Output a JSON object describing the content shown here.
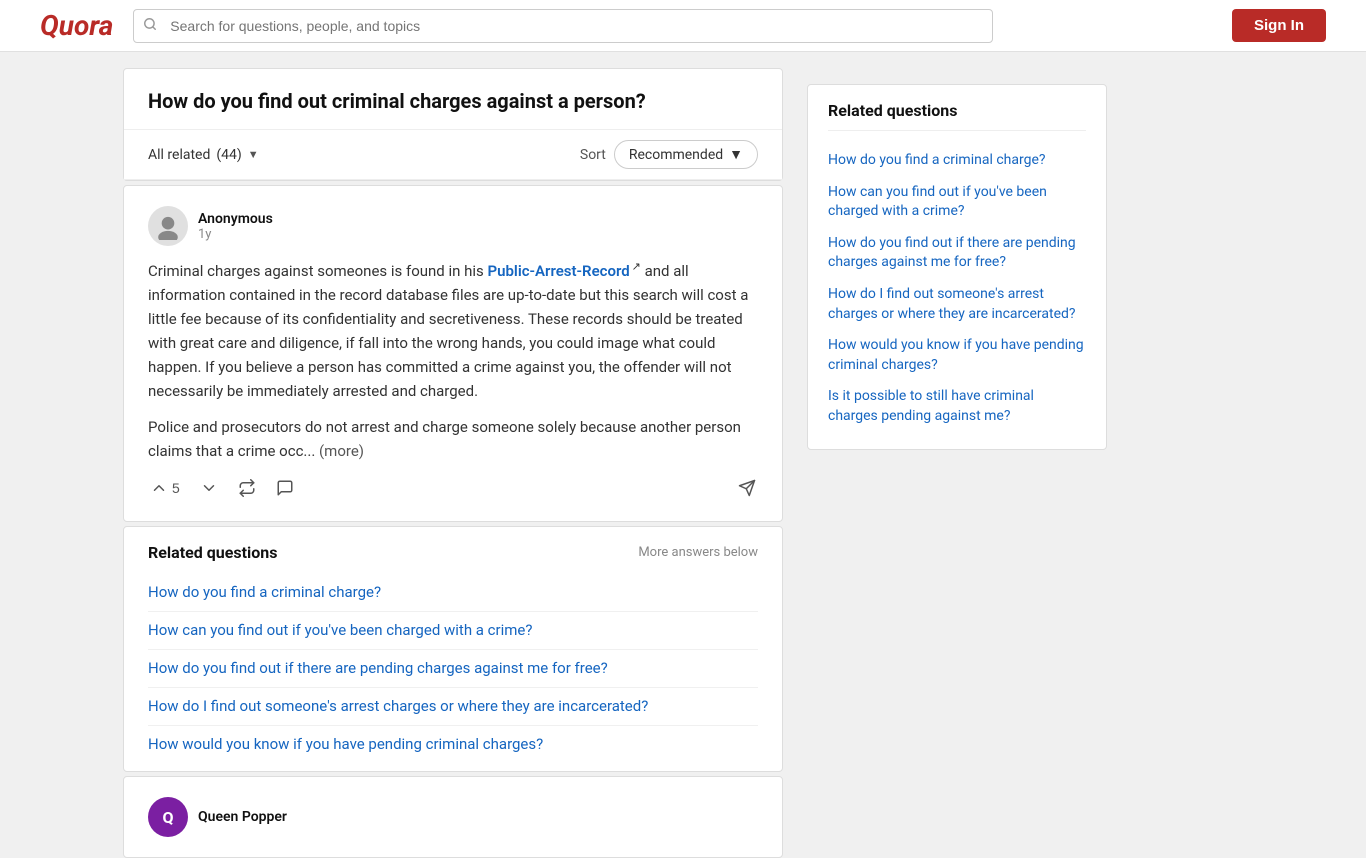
{
  "header": {
    "logo": "Quora",
    "search_placeholder": "Search for questions, people, and topics",
    "sign_in_label": "Sign In"
  },
  "question": {
    "title": "How do you find out criminal charges against a person?"
  },
  "filter": {
    "all_related_label": "All related",
    "all_related_count": "(44)",
    "sort_label": "Sort",
    "sort_value": "Recommended"
  },
  "answer": {
    "author_name": "Anonymous",
    "time_ago": "1y",
    "link_text": "Public-Arrest-Record",
    "body_before_link": "Criminal charges against someones is found in his ",
    "body_after_link": " and all information contained in the record database files are up-to-date but this search will cost a little fee because of its confidentiality and secretiveness. These records should be treated with great care and diligence, if fall into the wrong hands, you could image what could happen. If you believe a person has committed a crime against you, the offender will not necessarily be immediately arrested and charged.",
    "body_para2": "Police and prosecutors do not arrest and charge someone solely because another person claims that a crime occ...",
    "more_label": "(more)",
    "upvote_count": "5",
    "actions": {
      "upvote": "upvote",
      "downvote": "downvote",
      "share_answer": "share",
      "comment": "comment"
    }
  },
  "related_inline": {
    "title": "Related questions",
    "more_answers": "More answers below",
    "links": [
      "How do you find a criminal charge?",
      "How can you find out if you've been charged with a crime?",
      "How do you find out if there are pending charges against me for free?",
      "How do I find out someone's arrest charges or where they are incarcerated?",
      "How would you know if you have pending criminal charges?"
    ]
  },
  "next_answer_author": "Queen Popper",
  "sidebar": {
    "title": "Related questions",
    "links": [
      "How do you find a criminal charge?",
      "How can you find out if you've been charged with a crime?",
      "How do you find out if there are pending charges against me for free?",
      "How do I find out someone's arrest charges or where they are incarcerated?",
      "How would you know if you have pending criminal charges?",
      "Is it possible to still have criminal charges pending against me?"
    ]
  }
}
